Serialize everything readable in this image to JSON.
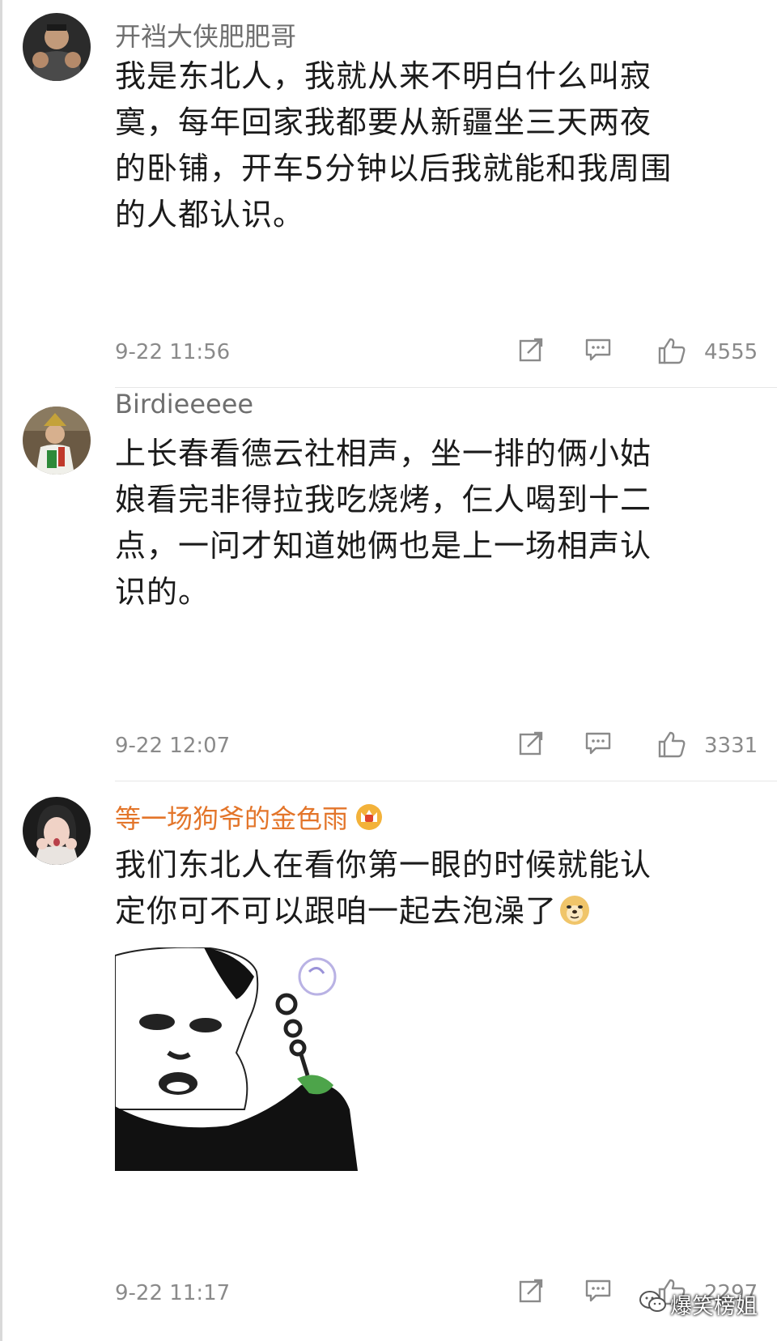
{
  "comments": [
    {
      "username": "开裆大侠肥肥哥",
      "lines": [
        "我是东北人，我就从来不明白什么叫寂",
        "寞，每年回家我都要从新疆坐三天两夜",
        "的卧铺，开车5分钟以后我就能和我周围",
        "的人都认识。"
      ],
      "time": "9-22 11:56",
      "likes": "4555",
      "avatar_icon": "muscle-man-avatar-icon"
    },
    {
      "username": "Birdieeeee",
      "lines": [
        "上长春看德云社相声，坐一排的俩小姑",
        "娘看完非得拉我吃烧烤，仨人喝到十二",
        "点，一问才知道她俩也是上一场相声认",
        "识的。"
      ],
      "time": "9-22 12:07",
      "likes": "3331",
      "avatar_icon": "costume-avatar-icon"
    },
    {
      "username": "等一场狗爷的金色雨",
      "lines": [
        "我们东北人在看你第一眼的时候就能认",
        "定你可不可以跟咱一起去泡澡了"
      ],
      "time": "9-22 11:17",
      "likes": "2297",
      "avatar_icon": "girl-avatar-icon",
      "vip_badge_icon": "crown-badge-icon",
      "inline_emoji_icon": "doge-emoji-icon",
      "meme_image_icon": "panda-bubble-meme-icon"
    }
  ],
  "watermark": {
    "text": "爆笑榜姐",
    "icon": "wechat-logo-icon"
  },
  "colors": {
    "vip_name": "#e3752a",
    "text": "#1b1b1b",
    "meta": "#8a8a8a",
    "divider": "#e6e6e6"
  }
}
